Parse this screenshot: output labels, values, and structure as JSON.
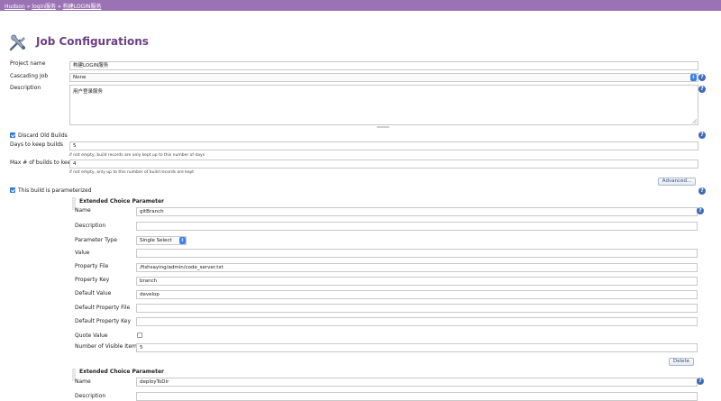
{
  "breadcrumbs": [
    "Hudson",
    "login服务",
    "构建LOGIN服务"
  ],
  "breadcrumb_separator": "»",
  "page_title": "Job Configurations",
  "fields": {
    "project_name": {
      "label": "Project name",
      "value": "构建LOGIN服务"
    },
    "cascading_job": {
      "label": "Cascading Job",
      "value": "None"
    },
    "description": {
      "label": "Description",
      "value": "用户登录服务"
    }
  },
  "discard_old_builds": {
    "label": "Discard Old Builds",
    "checked": true,
    "days_label": "Days to keep builds",
    "days_value": "5",
    "days_hint": "if not empty, build records are only kept up to this number of days",
    "max_label": "Max # of builds to keep",
    "max_value": "4",
    "max_hint": "if not empty, only up to this number of build records are kept",
    "advanced_label": "Advanced..."
  },
  "parameterized": {
    "label": "This build is parameterized",
    "checked": true
  },
  "param1": {
    "title": "Extended Choice Parameter",
    "name_label": "Name",
    "name_value": "gitBranch",
    "description_label": "Description",
    "description_value": "",
    "type_label": "Parameter Type",
    "type_value": "Single Select",
    "value_label": "Value",
    "value_value": "",
    "property_file_label": "Property File",
    "property_file_value": "/fishsaying/admin/code_server.txt",
    "property_key_label": "Property Key",
    "property_key_value": "branch",
    "default_value_label": "Default Value",
    "default_value_value": "develop",
    "default_property_file_label": "Default Property File",
    "default_property_file_value": "",
    "default_property_key_label": "Default Property Key",
    "default_property_key_value": "",
    "quote_value_label": "Quote Value",
    "quote_value_checked": false,
    "visible_items_label": "Number of Visible Items",
    "visible_items_value": "5",
    "delete_label": "Delete"
  },
  "param2": {
    "title": "Extended Choice Parameter",
    "name_label": "Name",
    "name_value": "deployToDir",
    "description_label": "Description",
    "description_value": ""
  },
  "icons": {
    "help": "help-icon",
    "title": "tools-icon",
    "select": "chevron-updown-icon"
  },
  "help_glyph": "?",
  "select_glyph": "⇕",
  "colors": {
    "topbar": "#9b73b4",
    "title": "#6b3f86",
    "help": "#3e6bb8",
    "accent": "#3b82f0"
  }
}
